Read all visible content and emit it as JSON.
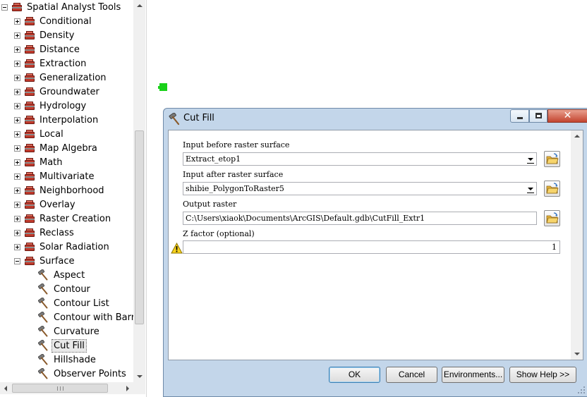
{
  "tree": {
    "root_label": "Spatial Analyst Tools",
    "toolsets": [
      "Conditional",
      "Density",
      "Distance",
      "Extraction",
      "Generalization",
      "Groundwater",
      "Hydrology",
      "Interpolation",
      "Local",
      "Map Algebra",
      "Math",
      "Multivariate",
      "Neighborhood",
      "Overlay",
      "Raster Creation",
      "Reclass",
      "Solar Radiation"
    ],
    "expanded_toolset": "Surface",
    "tools": [
      "Aspect",
      "Contour",
      "Contour List",
      "Contour with Barrie",
      "Curvature",
      "Cut Fill",
      "Hillshade",
      "Observer Points"
    ],
    "selected_tool": "Cut Fill"
  },
  "dialog": {
    "title": "Cut Fill",
    "fields": {
      "input_before_label": "Input before raster surface",
      "input_before_value": "Extract_etop1",
      "input_after_label": "Input after raster surface",
      "input_after_value": "shibie_PolygonToRaster5",
      "output_label": "Output raster",
      "output_value": "C:\\Users\\xiaok\\Documents\\ArcGIS\\Default.gdb\\CutFill_Extr1",
      "zfactor_label": "Z factor (optional)",
      "zfactor_value": "1"
    },
    "buttons": {
      "ok": "OK",
      "cancel": "Cancel",
      "environments": "Environments...",
      "show_help": "Show Help >>"
    },
    "close_glyph": "✕"
  },
  "icons": {
    "toolbox": "toolbox-icon",
    "tool": "hammer-icon",
    "browse": "open-folder-icon",
    "warning": "warning-icon"
  },
  "colors": {
    "marker": "#19d119",
    "dialog_frame": "#c3d6ea",
    "close_button": "#c3442f"
  }
}
